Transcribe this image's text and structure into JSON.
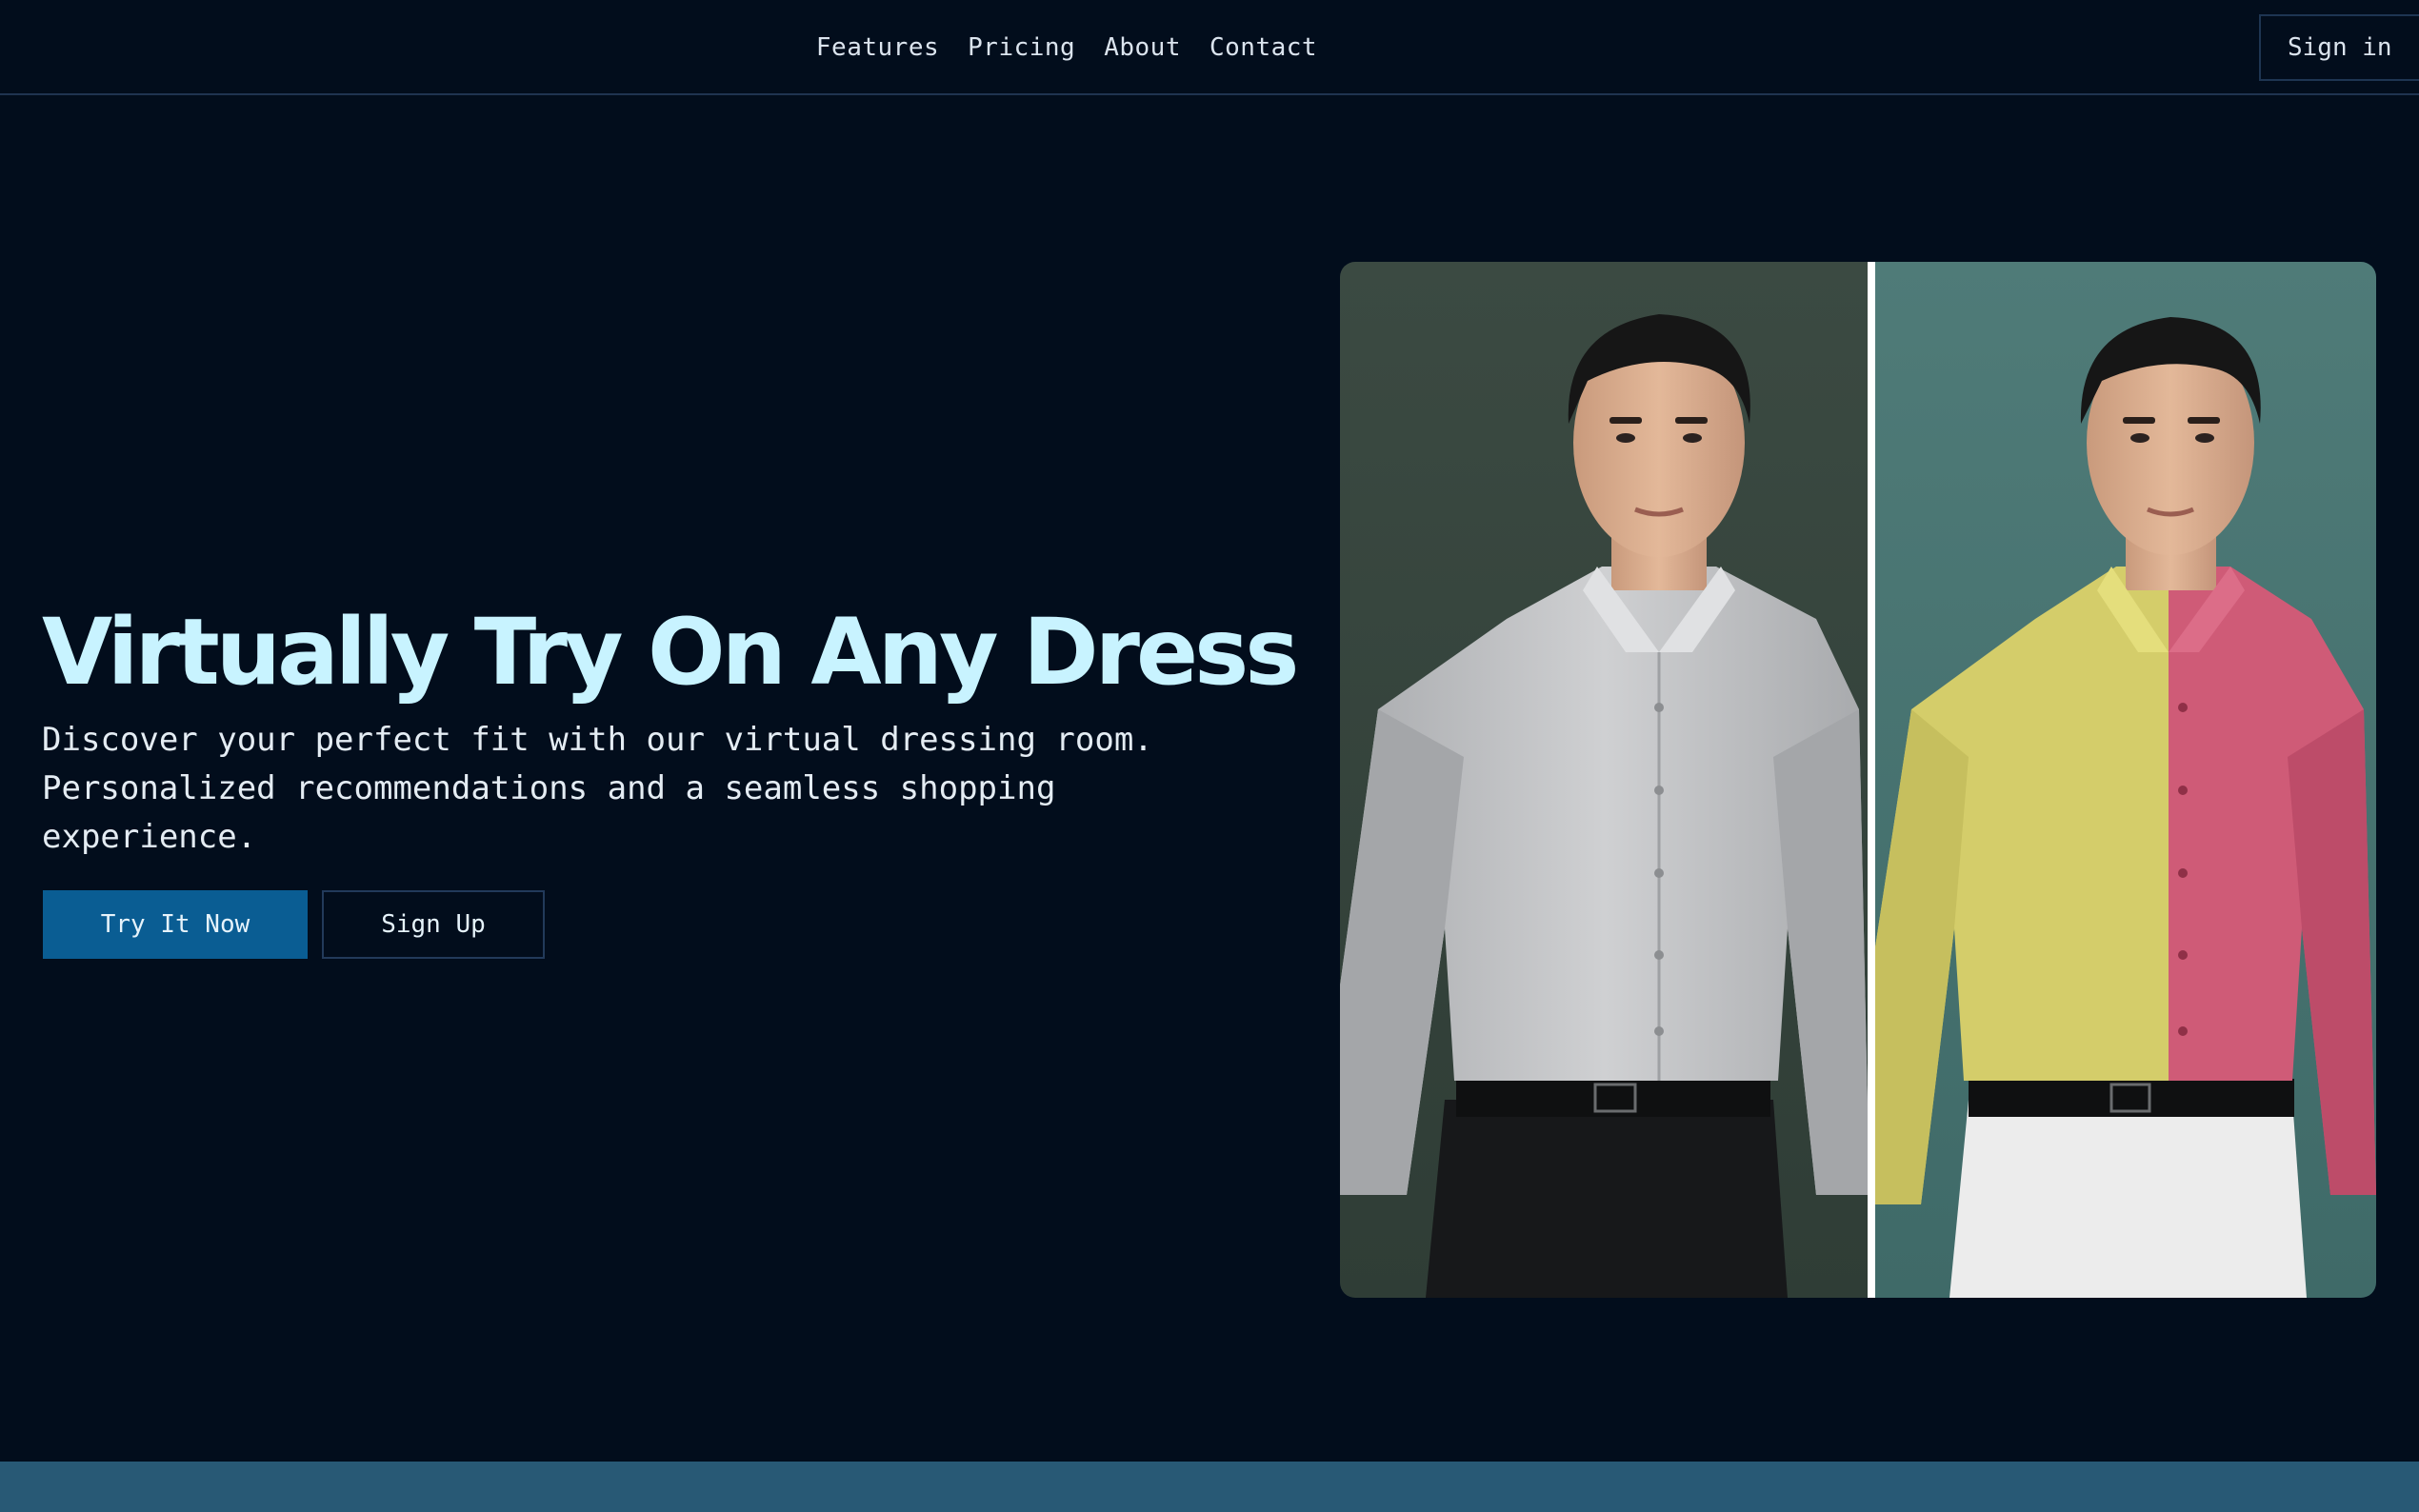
{
  "nav": {
    "links": [
      "Features",
      "Pricing",
      "About",
      "Contact"
    ],
    "signin_label": "Sign in"
  },
  "hero": {
    "title": "Virtually Try On Any Dress",
    "description": "Discover your perfect fit with our virtual dressing room. Personalized recommendations and a seamless shopping experience.",
    "primary_cta": "Try It Now",
    "secondary_cta": "Sign Up"
  },
  "comparison": {
    "divider_position": 0.51,
    "before_shirt_color": "#c7c8ca",
    "after_shirt_colors": [
      "#d4cd6a",
      "#cf5b77"
    ]
  },
  "colors": {
    "background": "#020d1c",
    "accent": "#0a5d93",
    "title": "#c8f3ff",
    "strip": "#285975"
  }
}
